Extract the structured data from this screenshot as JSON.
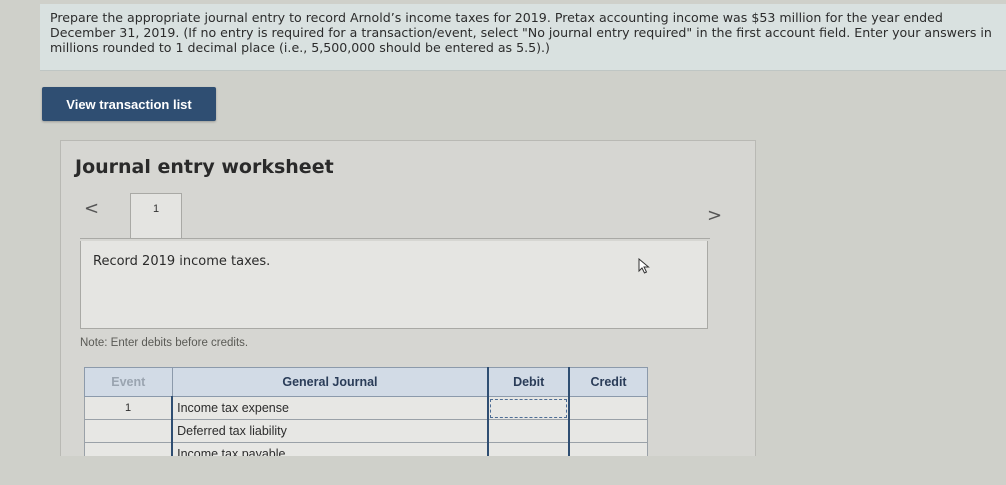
{
  "instructions": "Prepare the appropriate journal entry to record Arnold’s income taxes for 2019. Pretax accounting income was $53 million for the year ended December 31, 2019. (If no entry is required for a transaction/event, select \"No journal entry required\" in the first account field. Enter your answers in millions rounded to 1 decimal place (i.e., 5,500,000 should be entered as 5.5).)",
  "view_button_label": "View transaction list",
  "worksheet": {
    "title": "Journal entry worksheet",
    "prev_icon": "<",
    "next_icon": ">",
    "active_tab": "1",
    "description": "Record 2019 income taxes.",
    "note": "Note: Enter debits before credits."
  },
  "journal": {
    "headers": {
      "event": "Event",
      "general_journal": "General Journal",
      "debit": "Debit",
      "credit": "Credit"
    },
    "rows": [
      {
        "event": "1",
        "account": "Income tax expense",
        "debit": "",
        "credit": ""
      },
      {
        "event": "",
        "account": "Deferred tax liability",
        "debit": "",
        "credit": ""
      },
      {
        "event": "",
        "account": "Income tax payable",
        "debit": "",
        "credit": ""
      }
    ]
  },
  "icons": {
    "cursor": "pointer-cursor-icon"
  }
}
